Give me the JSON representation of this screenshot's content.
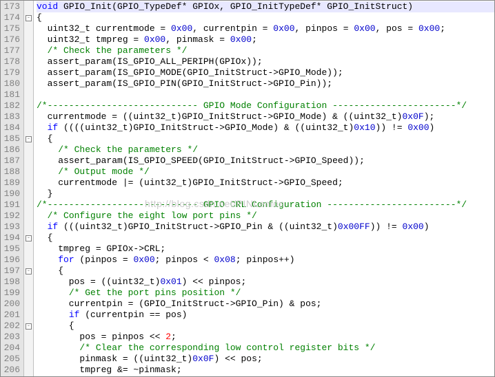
{
  "watermark": "http://blog.csdn.net/PINLemon",
  "lines": [
    {
      "num": 173,
      "fold": "",
      "html": "<span class='kw'>void</span> GPIO_Init(GPIO_TypeDef* GPIOx, GPIO_InitTypeDef* GPIO_InitStruct)",
      "hl": true
    },
    {
      "num": 174,
      "fold": "box-",
      "html": "{"
    },
    {
      "num": 175,
      "fold": "",
      "html": "  uint32_t currentmode = <span class='hex'>0x00</span>, currentpin = <span class='hex'>0x00</span>, pinpos = <span class='hex'>0x00</span>, pos = <span class='hex'>0x00</span>;"
    },
    {
      "num": 176,
      "fold": "",
      "html": "  uint32_t tmpreg = <span class='hex'>0x00</span>, pinmask = <span class='hex'>0x00</span>;"
    },
    {
      "num": 177,
      "fold": "",
      "html": "  <span class='cm'>/* Check the parameters */</span>"
    },
    {
      "num": 178,
      "fold": "",
      "html": "  assert_param(IS_GPIO_ALL_PERIPH(GPIOx));"
    },
    {
      "num": 179,
      "fold": "",
      "html": "  assert_param(IS_GPIO_MODE(GPIO_InitStruct-&gt;GPIO_Mode));"
    },
    {
      "num": 180,
      "fold": "",
      "html": "  assert_param(IS_GPIO_PIN(GPIO_InitStruct-&gt;GPIO_Pin));"
    },
    {
      "num": 181,
      "fold": "",
      "html": ""
    },
    {
      "num": 182,
      "fold": "",
      "html": "<span class='cm'>/*---------------------------- GPIO Mode Configuration -----------------------*/</span>"
    },
    {
      "num": 183,
      "fold": "",
      "html": "  currentmode = ((uint32_t)GPIO_InitStruct-&gt;GPIO_Mode) &amp; ((uint32_t)<span class='hex'>0x0F</span>);"
    },
    {
      "num": 184,
      "fold": "",
      "html": "  <span class='kw'>if</span> ((((uint32_t)GPIO_InitStruct-&gt;GPIO_Mode) &amp; ((uint32_t)<span class='hex'>0x10</span>)) != <span class='hex'>0x00</span>)"
    },
    {
      "num": 185,
      "fold": "box-",
      "html": "  {"
    },
    {
      "num": 186,
      "fold": "",
      "html": "    <span class='cm'>/* Check the parameters */</span>"
    },
    {
      "num": 187,
      "fold": "",
      "html": "    assert_param(IS_GPIO_SPEED(GPIO_InitStruct-&gt;GPIO_Speed));"
    },
    {
      "num": 188,
      "fold": "",
      "html": "    <span class='cm'>/* Output mode */</span>"
    },
    {
      "num": 189,
      "fold": "",
      "html": "    currentmode |= (uint32_t)GPIO_InitStruct-&gt;GPIO_Speed;"
    },
    {
      "num": 190,
      "fold": "",
      "html": "  }"
    },
    {
      "num": 191,
      "fold": "",
      "html": "<span class='cm'>/*---------------------------- GPIO CRL Configuration ------------------------*/</span>"
    },
    {
      "num": 192,
      "fold": "",
      "html": "  <span class='cm'>/* Configure the eight low port pins */</span>"
    },
    {
      "num": 193,
      "fold": "",
      "html": "  <span class='kw'>if</span> (((uint32_t)GPIO_InitStruct-&gt;GPIO_Pin &amp; ((uint32_t)<span class='hex'>0x00FF</span>)) != <span class='hex'>0x00</span>)"
    },
    {
      "num": 194,
      "fold": "box-",
      "html": "  {"
    },
    {
      "num": 195,
      "fold": "",
      "html": "    tmpreg = GPIOx-&gt;CRL;"
    },
    {
      "num": 196,
      "fold": "",
      "html": "    <span class='kw'>for</span> (pinpos = <span class='hex'>0x00</span>; pinpos &lt; <span class='hex'>0x08</span>; pinpos++)"
    },
    {
      "num": 197,
      "fold": "box-",
      "html": "    {"
    },
    {
      "num": 198,
      "fold": "",
      "html": "      pos = ((uint32_t)<span class='hex'>0x01</span>) &lt;&lt; pinpos;"
    },
    {
      "num": 199,
      "fold": "",
      "html": "      <span class='cm'>/* Get the port pins position */</span>"
    },
    {
      "num": 200,
      "fold": "",
      "html": "      currentpin = (GPIO_InitStruct-&gt;GPIO_Pin) &amp; pos;"
    },
    {
      "num": 201,
      "fold": "",
      "html": "      <span class='kw'>if</span> (currentpin == pos)"
    },
    {
      "num": 202,
      "fold": "box-",
      "html": "      {"
    },
    {
      "num": 203,
      "fold": "",
      "html": "        pos = pinpos &lt;&lt; <span class='num'>2</span>;"
    },
    {
      "num": 204,
      "fold": "",
      "html": "        <span class='cm'>/* Clear the corresponding low control register bits */</span>"
    },
    {
      "num": 205,
      "fold": "",
      "html": "        pinmask = ((uint32_t)<span class='hex'>0x0F</span>) &lt;&lt; pos;"
    },
    {
      "num": 206,
      "fold": "",
      "html": "        tmpreg &amp;= ~pinmask;"
    }
  ]
}
